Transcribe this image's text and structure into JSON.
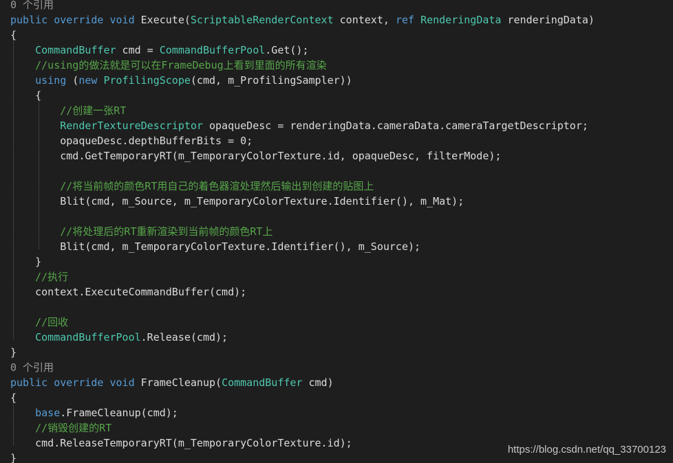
{
  "colors": {
    "background": "#1e1e1e",
    "keyword": "#569cd6",
    "type": "#4ec9b0",
    "comment": "#57a64a",
    "text": "#dcdcdc",
    "reference_hint": "#9b9b9b"
  },
  "code_lines": [
    [
      {
        "t": "0 个引用",
        "c": "ref"
      }
    ],
    [
      {
        "t": "public override void ",
        "c": "kw"
      },
      {
        "t": "Execute(",
        "c": "tx"
      },
      {
        "t": "ScriptableRenderContext",
        "c": "ty"
      },
      {
        "t": " context, ",
        "c": "tx"
      },
      {
        "t": "ref ",
        "c": "kw"
      },
      {
        "t": "RenderingData",
        "c": "ty"
      },
      {
        "t": " renderingData)",
        "c": "tx"
      }
    ],
    [
      {
        "t": "{",
        "c": "tx"
      }
    ],
    [
      {
        "t": "    ",
        "c": "tx"
      },
      {
        "t": "CommandBuffer",
        "c": "ty"
      },
      {
        "t": " cmd = ",
        "c": "tx"
      },
      {
        "t": "CommandBufferPool",
        "c": "ty"
      },
      {
        "t": ".Get();",
        "c": "tx"
      }
    ],
    [
      {
        "t": "    ",
        "c": "tx"
      },
      {
        "t": "//using的做法就是可以在FrameDebug上看到里面的所有渲染",
        "c": "cm"
      }
    ],
    [
      {
        "t": "    ",
        "c": "tx"
      },
      {
        "t": "using",
        "c": "kw"
      },
      {
        "t": " (",
        "c": "tx"
      },
      {
        "t": "new ",
        "c": "kw"
      },
      {
        "t": "ProfilingScope",
        "c": "ty"
      },
      {
        "t": "(cmd, m_ProfilingSampler))",
        "c": "tx"
      }
    ],
    [
      {
        "t": "    {",
        "c": "tx"
      }
    ],
    [
      {
        "t": "        ",
        "c": "tx"
      },
      {
        "t": "//创建一张RT",
        "c": "cm"
      }
    ],
    [
      {
        "t": "        ",
        "c": "tx"
      },
      {
        "t": "RenderTextureDescriptor",
        "c": "ty"
      },
      {
        "t": " opaqueDesc = renderingData.cameraData.cameraTargetDescriptor;",
        "c": "tx"
      }
    ],
    [
      {
        "t": "        opaqueDesc.depthBufferBits = 0;",
        "c": "tx"
      }
    ],
    [
      {
        "t": "        cmd.GetTemporaryRT(m_TemporaryColorTexture.id, opaqueDesc, filterMode);",
        "c": "tx"
      }
    ],
    [],
    [
      {
        "t": "        ",
        "c": "tx"
      },
      {
        "t": "//将当前帧的颜色RT用自己的着色器渲处理然后输出到创建的贴图上",
        "c": "cm"
      }
    ],
    [
      {
        "t": "        Blit(cmd, m_Source, m_TemporaryColorTexture.Identifier(), m_Mat);",
        "c": "tx"
      }
    ],
    [],
    [
      {
        "t": "        ",
        "c": "tx"
      },
      {
        "t": "//将处理后的RT重新渲染到当前帧的颜色RT上",
        "c": "cm"
      }
    ],
    [
      {
        "t": "        Blit(cmd, m_TemporaryColorTexture.Identifier(), m_Source);",
        "c": "tx"
      }
    ],
    [
      {
        "t": "    }",
        "c": "tx"
      }
    ],
    [
      {
        "t": "    ",
        "c": "tx"
      },
      {
        "t": "//执行",
        "c": "cm"
      }
    ],
    [
      {
        "t": "    context.ExecuteCommandBuffer(cmd);",
        "c": "tx"
      }
    ],
    [],
    [
      {
        "t": "    ",
        "c": "tx"
      },
      {
        "t": "//回收",
        "c": "cm"
      }
    ],
    [
      {
        "t": "    ",
        "c": "tx"
      },
      {
        "t": "CommandBufferPool",
        "c": "ty"
      },
      {
        "t": ".Release(cmd);",
        "c": "tx"
      }
    ],
    [
      {
        "t": "}",
        "c": "tx"
      }
    ],
    [
      {
        "t": "0 个引用",
        "c": "ref"
      }
    ],
    [
      {
        "t": "public override void ",
        "c": "kw"
      },
      {
        "t": "FrameCleanup(",
        "c": "tx"
      },
      {
        "t": "CommandBuffer",
        "c": "ty"
      },
      {
        "t": " cmd)",
        "c": "tx"
      }
    ],
    [
      {
        "t": "{",
        "c": "tx"
      }
    ],
    [
      {
        "t": "    ",
        "c": "tx"
      },
      {
        "t": "base",
        "c": "kw"
      },
      {
        "t": ".FrameCleanup(cmd);",
        "c": "tx"
      }
    ],
    [
      {
        "t": "    ",
        "c": "tx"
      },
      {
        "t": "//销毁创建的RT",
        "c": "cm"
      }
    ],
    [
      {
        "t": "    cmd.ReleaseTemporaryRT(m_TemporaryColorTexture.id);",
        "c": "tx"
      }
    ],
    [
      {
        "t": "}",
        "c": "tx"
      }
    ]
  ],
  "watermark": "https://blog.csdn.net/qq_33700123"
}
